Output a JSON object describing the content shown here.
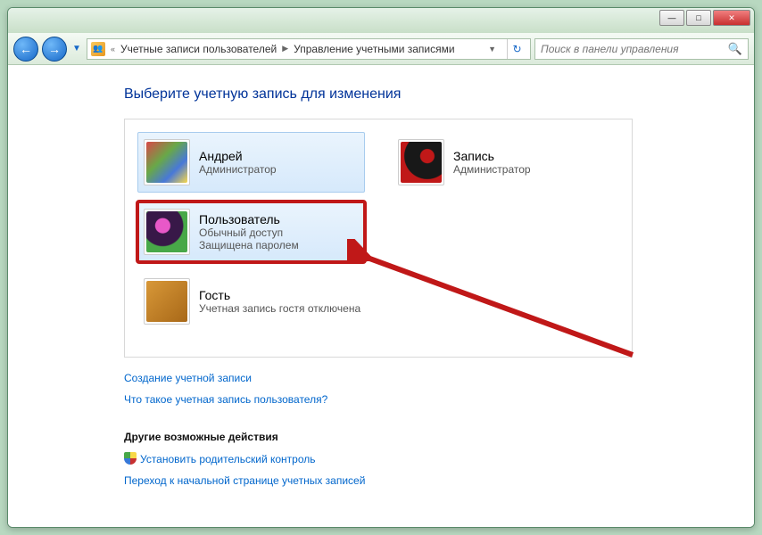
{
  "breadcrumb": {
    "item1": "Учетные записи пользователей",
    "item2": "Управление учетными записями"
  },
  "search": {
    "placeholder": "Поиск в панели управления"
  },
  "heading": "Выберите учетную запись для изменения",
  "accounts": [
    {
      "name": "Андрей",
      "role": "Администратор",
      "extra": ""
    },
    {
      "name": "Запись",
      "role": "Администратор",
      "extra": ""
    },
    {
      "name": "Пользователь",
      "role": "Обычный доступ",
      "extra": "Защищена паролем"
    },
    {
      "name": "Гость",
      "role": "Учетная запись гостя отключена",
      "extra": ""
    }
  ],
  "links": {
    "create": "Создание учетной записи",
    "what_is": "Что такое учетная запись пользователя?",
    "section": "Другие возможные действия",
    "parental": "Установить родительский контроль",
    "home": "Переход к начальной странице учетных записей"
  }
}
